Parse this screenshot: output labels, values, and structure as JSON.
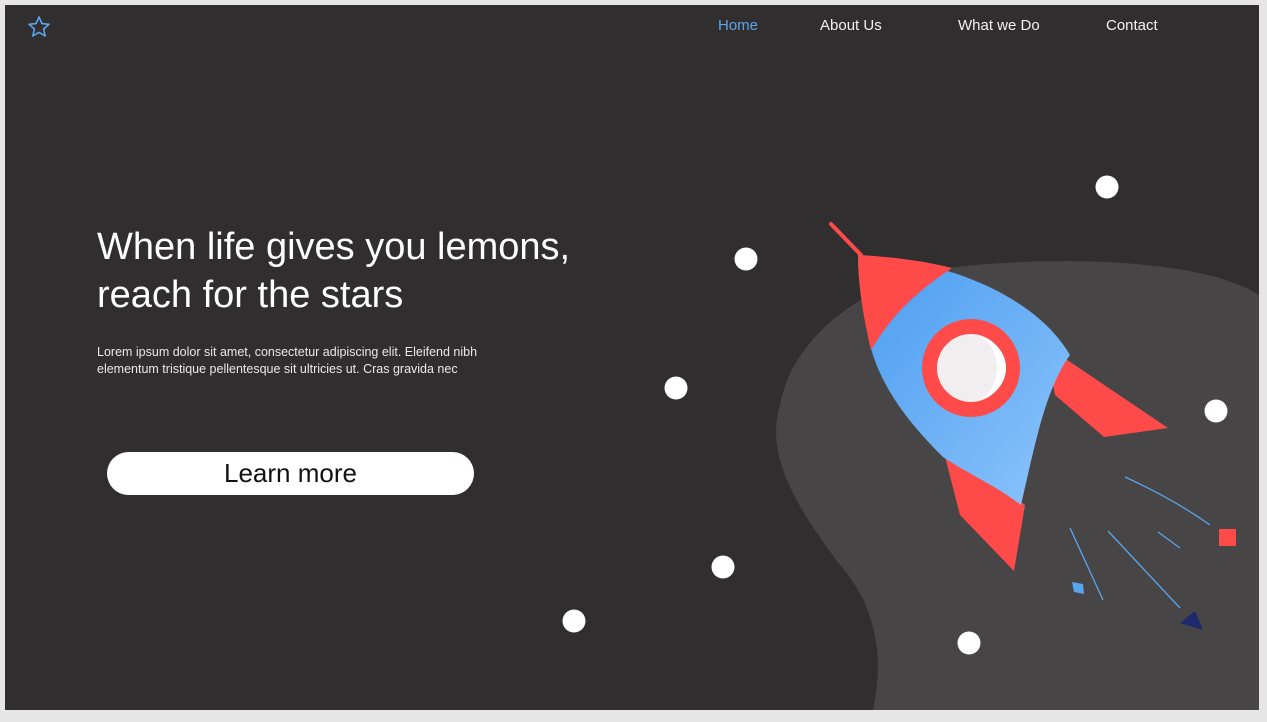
{
  "header": {
    "logo_icon": "star-outline-icon",
    "nav": [
      {
        "label": "Home",
        "active": true
      },
      {
        "label": "About Us",
        "active": false
      },
      {
        "label": "What we Do",
        "active": false
      },
      {
        "label": "Contact",
        "active": false
      }
    ]
  },
  "hero": {
    "title_line1": "When life gives you lemons,",
    "title_line2": "reach for the stars",
    "text_line1": "Lorem ipsum dolor sit amet, consectetur adipiscing elit. Eleifend nibh",
    "text_line2": "elementum tristique pellentesque sit ultricies ut. Cras gravida nec",
    "cta_label": "Learn more"
  },
  "illustration": {
    "name": "rocket-illustration"
  },
  "colors": {
    "background": "#312e2f",
    "accent_blue": "#5aa6ee",
    "rocket_red": "#ff4a4a",
    "blob": "#484546"
  }
}
